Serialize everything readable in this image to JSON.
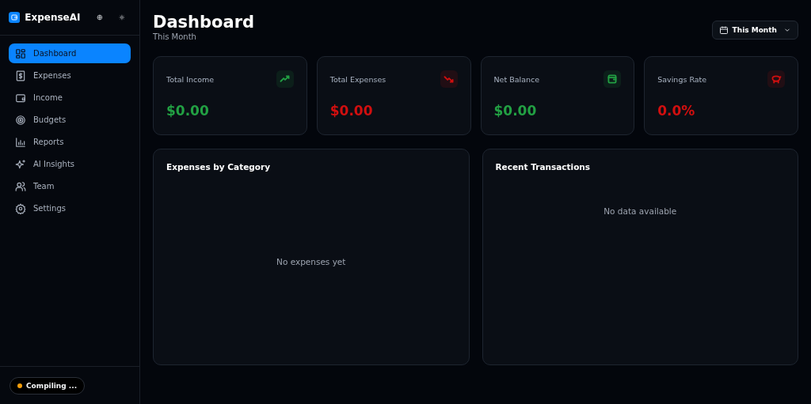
{
  "app": {
    "name": "ExpenseAI"
  },
  "nav": [
    {
      "label": "Dashboard",
      "kind": "grid",
      "selected": true
    },
    {
      "label": "Expenses",
      "kind": "receipt",
      "selected": false
    },
    {
      "label": "Income",
      "kind": "wallet",
      "selected": false
    },
    {
      "label": "Budgets",
      "kind": "target",
      "selected": false
    },
    {
      "label": "Reports",
      "kind": "chart",
      "selected": false
    },
    {
      "label": "AI Insights",
      "kind": "sparkles",
      "selected": false
    },
    {
      "label": "Team",
      "kind": "users",
      "selected": false
    },
    {
      "label": "Settings",
      "kind": "gear",
      "selected": false
    }
  ],
  "status": {
    "label": "Compiling ...",
    "color": "#f59e0b"
  },
  "header": {
    "title": "Dashboard",
    "subtitle": "This Month",
    "period": "This Month"
  },
  "stats": [
    {
      "label": "Total Income",
      "value": "$0.00",
      "kind": "trend-up",
      "color": "#22a043"
    },
    {
      "label": "Total Expenses",
      "value": "$0.00",
      "kind": "trend-down",
      "color": "#d10f0f"
    },
    {
      "label": "Net Balance",
      "value": "$0.00",
      "kind": "wallet",
      "color": "#22a043"
    },
    {
      "label": "Savings Rate",
      "value": "0.0%",
      "kind": "piggy",
      "color": "#d10f0f"
    }
  ],
  "panels": [
    {
      "title": "Expenses by Category",
      "empty": "No expenses yet",
      "kind": "centered"
    },
    {
      "title": "Recent Transactions",
      "empty": "No data available",
      "kind": "top"
    }
  ]
}
